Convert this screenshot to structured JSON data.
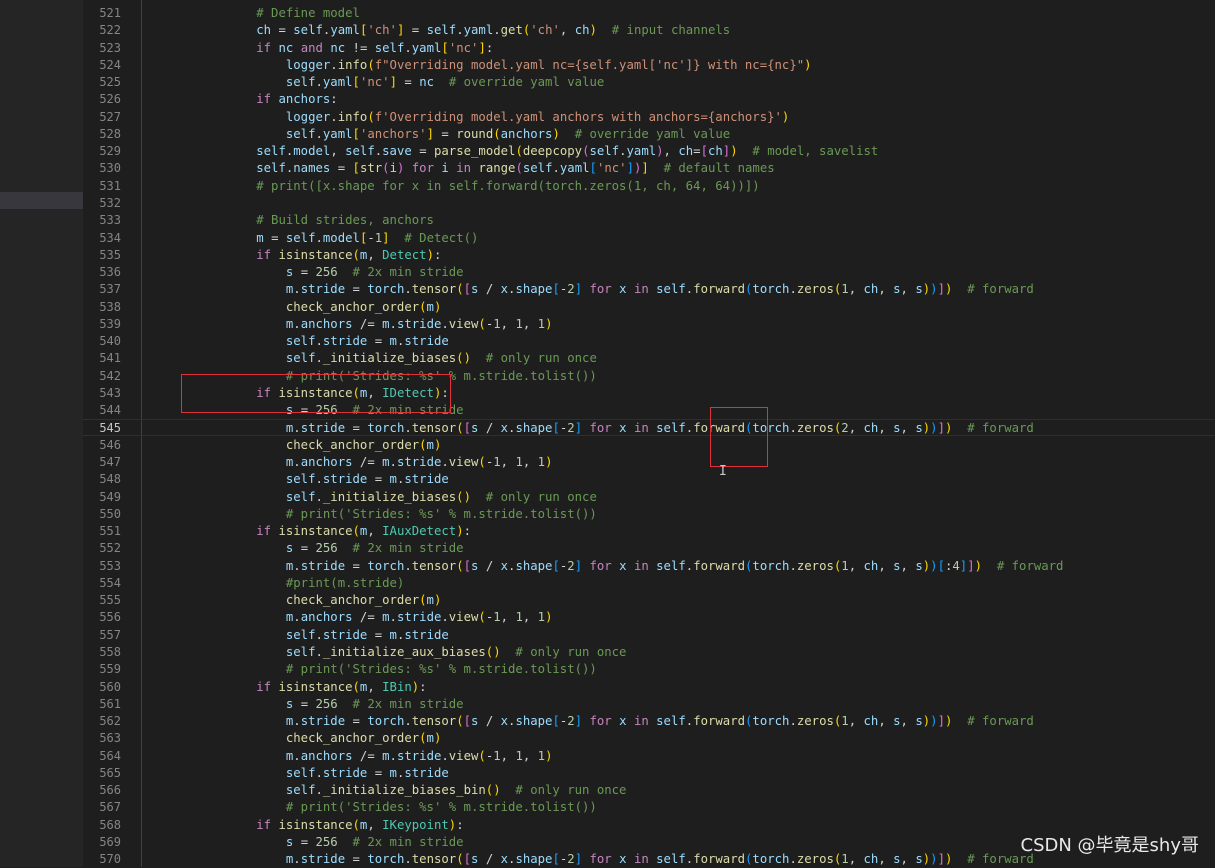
{
  "window": {
    "watermark": "CSDN @毕竟是shy哥"
  },
  "editor": {
    "current_line": 545,
    "lines": [
      {
        "n": 521,
        "t": "        # Define model"
      },
      {
        "n": 522,
        "t": "        ch = self.yaml['ch'] = self.yaml.get('ch', ch)  # input channels"
      },
      {
        "n": 523,
        "t": "        if nc and nc != self.yaml['nc']:"
      },
      {
        "n": 524,
        "t": "            logger.info(f\"Overriding model.yaml nc={self.yaml['nc']} with nc={nc}\")"
      },
      {
        "n": 525,
        "t": "            self.yaml['nc'] = nc  # override yaml value"
      },
      {
        "n": 526,
        "t": "        if anchors:"
      },
      {
        "n": 527,
        "t": "            logger.info(f'Overriding model.yaml anchors with anchors={anchors}')"
      },
      {
        "n": 528,
        "t": "            self.yaml['anchors'] = round(anchors)  # override yaml value"
      },
      {
        "n": 529,
        "t": "        self.model, self.save = parse_model(deepcopy(self.yaml), ch=[ch])  # model, savelist"
      },
      {
        "n": 530,
        "t": "        self.names = [str(i) for i in range(self.yaml['nc'])]  # default names"
      },
      {
        "n": 531,
        "t": "        # print([x.shape for x in self.forward(torch.zeros(1, ch, 64, 64))])"
      },
      {
        "n": 532,
        "t": ""
      },
      {
        "n": 533,
        "t": "        # Build strides, anchors"
      },
      {
        "n": 534,
        "t": "        m = self.model[-1]  # Detect()"
      },
      {
        "n": 535,
        "t": "        if isinstance(m, Detect):"
      },
      {
        "n": 536,
        "t": "            s = 256  # 2x min stride"
      },
      {
        "n": 537,
        "t": "            m.stride = torch.tensor([s / x.shape[-2] for x in self.forward(torch.zeros(1, ch, s, s))])  # forward"
      },
      {
        "n": 538,
        "t": "            check_anchor_order(m)"
      },
      {
        "n": 539,
        "t": "            m.anchors /= m.stride.view(-1, 1, 1)"
      },
      {
        "n": 540,
        "t": "            self.stride = m.stride"
      },
      {
        "n": 541,
        "t": "            self._initialize_biases()  # only run once"
      },
      {
        "n": 542,
        "t": "            # print('Strides: %s' % m.stride.tolist())"
      },
      {
        "n": 543,
        "t": "        if isinstance(m, IDetect):"
      },
      {
        "n": 544,
        "t": "            s = 256  # 2x min stride"
      },
      {
        "n": 545,
        "t": "            m.stride = torch.tensor([s / x.shape[-2] for x in self.forward(torch.zeros(2, ch, s, s))])  # forward"
      },
      {
        "n": 546,
        "t": "            check_anchor_order(m)"
      },
      {
        "n": 547,
        "t": "            m.anchors /= m.stride.view(-1, 1, 1)"
      },
      {
        "n": 548,
        "t": "            self.stride = m.stride"
      },
      {
        "n": 549,
        "t": "            self._initialize_biases()  # only run once"
      },
      {
        "n": 550,
        "t": "            # print('Strides: %s' % m.stride.tolist())"
      },
      {
        "n": 551,
        "t": "        if isinstance(m, IAuxDetect):"
      },
      {
        "n": 552,
        "t": "            s = 256  # 2x min stride"
      },
      {
        "n": 553,
        "t": "            m.stride = torch.tensor([s / x.shape[-2] for x in self.forward(torch.zeros(1, ch, s, s))[:4]])  # forward"
      },
      {
        "n": 554,
        "t": "            #print(m.stride)"
      },
      {
        "n": 555,
        "t": "            check_anchor_order(m)"
      },
      {
        "n": 556,
        "t": "            m.anchors /= m.stride.view(-1, 1, 1)"
      },
      {
        "n": 557,
        "t": "            self.stride = m.stride"
      },
      {
        "n": 558,
        "t": "            self._initialize_aux_biases()  # only run once"
      },
      {
        "n": 559,
        "t": "            # print('Strides: %s' % m.stride.tolist())"
      },
      {
        "n": 560,
        "t": "        if isinstance(m, IBin):"
      },
      {
        "n": 561,
        "t": "            s = 256  # 2x min stride"
      },
      {
        "n": 562,
        "t": "            m.stride = torch.tensor([s / x.shape[-2] for x in self.forward(torch.zeros(1, ch, s, s))])  # forward"
      },
      {
        "n": 563,
        "t": "            check_anchor_order(m)"
      },
      {
        "n": 564,
        "t": "            m.anchors /= m.stride.view(-1, 1, 1)"
      },
      {
        "n": 565,
        "t": "            self.stride = m.stride"
      },
      {
        "n": 566,
        "t": "            self._initialize_biases_bin()  # only run once"
      },
      {
        "n": 567,
        "t": "            # print('Strides: %s' % m.stride.tolist())"
      },
      {
        "n": 568,
        "t": "        if isinstance(m, IKeypoint):"
      },
      {
        "n": 569,
        "t": "            s = 256  # 2x min stride"
      },
      {
        "n": 570,
        "t": "            m.stride = torch.tensor([s / x.shape[-2] for x in self.forward(torch.zeros(1, ch, s, s))])  # forward"
      }
    ]
  },
  "icons": {
    "text-cursor": "text-cursor-icon"
  },
  "colors": {
    "background": "#1e1e1e",
    "annotation_box": "#e0303a",
    "keyword": "#c586c0",
    "function": "#dcdcaa",
    "comment": "#6a9955"
  }
}
